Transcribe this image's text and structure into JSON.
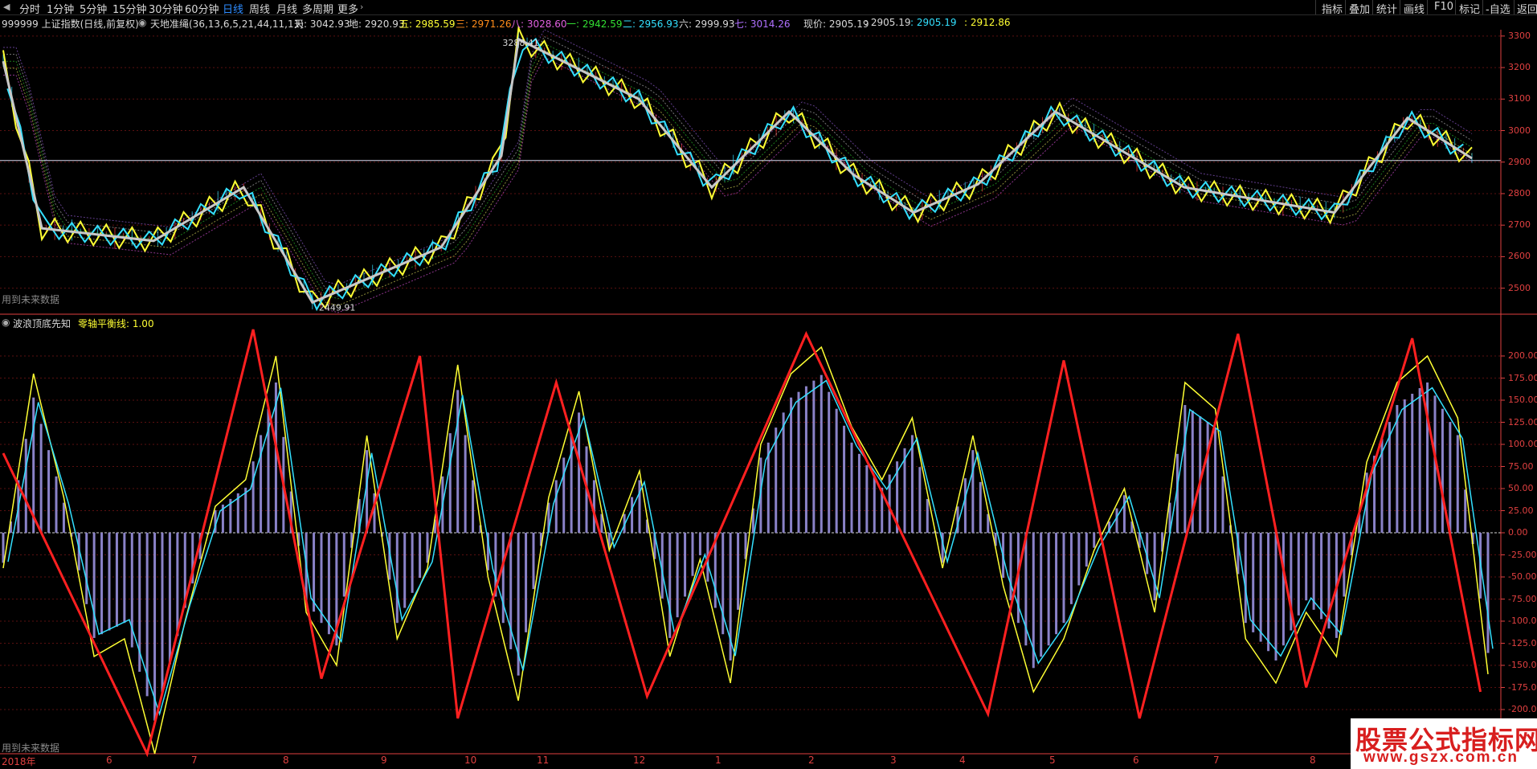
{
  "toolbar": {
    "periods": [
      "分时",
      "1分钟",
      "5分钟",
      "15分钟",
      "30分钟",
      "60分钟",
      "日线",
      "周线",
      "月线",
      "多周期",
      "更多"
    ],
    "active_period": "日线",
    "right": [
      "指标",
      "叠加",
      "统计",
      "画线",
      "F10",
      "标记",
      "-自选",
      "返回"
    ]
  },
  "info": {
    "code_name": "999999 上证指数(日线,前复权)",
    "indicator": "天地准绳(36,13,6,5,21,44,11,11)",
    "tian": "天: 3042.93",
    "di": "地: 2920.93",
    "wu": "五: 2985.59",
    "san": "三: 2971.26",
    "ba": "八: 3028.60",
    "yi": "一: 2942.59",
    "er": "二: 2956.93",
    "liu": "六: 2999.93",
    "qi": "七: 3014.26",
    "xianjia": "现价: 2905.19",
    "v2": ": 2905.19",
    "v3": ": 2905.19",
    "v4": ": 2912.86"
  },
  "main_note": "用到未来数据",
  "sub_note": "用到未来数据",
  "sub_title": {
    "name": "波浪顶底先知",
    "zero_line": "零轴平衡线: 1.00"
  },
  "colors": {
    "background": "#000000",
    "axis_red": "#e04040",
    "yellow": "#ffff33",
    "cyan": "#33e0ff",
    "grey_line": "#c8c8c8",
    "red_line": "#ff2020",
    "bars": "#8a82c8"
  },
  "chart_data": [
    {
      "type": "line",
      "title": "",
      "ylim": [
        2420,
        3320
      ],
      "yticks": [
        2500,
        2600,
        2700,
        2800,
        2900,
        3000,
        3100,
        3200,
        3300
      ],
      "annotations": [
        "3288.41",
        "2449.91"
      ],
      "ref_price": 2905.19,
      "series": [
        {
          "name": "",
          "kind": "wave-trend",
          "x": [
            0,
            9,
            35,
            56,
            72,
            102,
            116,
            120,
            148,
            165,
            183,
            198,
            212,
            227,
            245,
            275,
            310,
            327,
            342
          ],
          "values": [
            3220,
            2690,
            2650,
            2820,
            2455,
            2630,
            2920,
            3290,
            3100,
            2820,
            3060,
            2860,
            2740,
            2830,
            3060,
            2820,
            2740,
            3040,
            2912
          ]
        }
      ]
    },
    {
      "type": "bar",
      "title": "",
      "ylim": [
        -250,
        230
      ],
      "yticks": [
        200,
        175,
        150,
        125,
        100,
        75,
        50,
        25,
        0,
        -25,
        -50,
        -75,
        -100,
        -125,
        -150,
        -175,
        -200
      ],
      "zero_line": 1.0,
      "series": [
        {
          "name": "",
          "kind": "wave-red",
          "x": [
            0,
            19,
            33,
            42,
            55,
            60,
            73,
            85,
            106,
            130,
            140,
            150,
            163,
            172,
            186,
            195
          ],
          "values": [
            90,
            -270,
            230,
            -165,
            200,
            -210,
            170,
            -185,
            225,
            -205,
            195,
            -210,
            225,
            -175,
            220,
            -180
          ]
        },
        {
          "name": "",
          "kind": "histogram",
          "x": [
            0,
            4,
            8,
            12,
            16,
            20,
            24,
            28,
            32,
            36,
            40,
            44,
            48,
            52,
            56,
            60,
            64,
            68,
            72,
            76,
            80,
            84,
            88,
            92,
            96,
            100,
            104,
            108,
            112,
            116,
            120,
            124,
            128,
            132,
            136,
            140,
            144,
            148,
            152,
            156,
            160,
            164,
            168,
            172,
            176,
            180,
            184,
            188,
            192,
            196
          ],
          "values": [
            -40,
            180,
            40,
            -140,
            -120,
            -250,
            -100,
            30,
            60,
            200,
            -90,
            -150,
            110,
            -120,
            -40,
            190,
            -50,
            -190,
            40,
            160,
            -20,
            70,
            -140,
            -30,
            -170,
            100,
            180,
            210,
            120,
            60,
            130,
            -40,
            110,
            -60,
            -180,
            -120,
            -20,
            50,
            -90,
            170,
            140,
            -120,
            -170,
            -90,
            -140,
            80,
            170,
            200,
            130,
            -160
          ]
        }
      ]
    }
  ],
  "date_axis": [
    "2018年",
    "6",
    "7",
    "8",
    "9",
    "10",
    "11",
    "12",
    "1",
    "2",
    "3",
    "4",
    "5",
    "6",
    "7",
    "8"
  ],
  "watermark": {
    "main": "股票公式指标网",
    "sub": "www.gszx.com.cn"
  }
}
